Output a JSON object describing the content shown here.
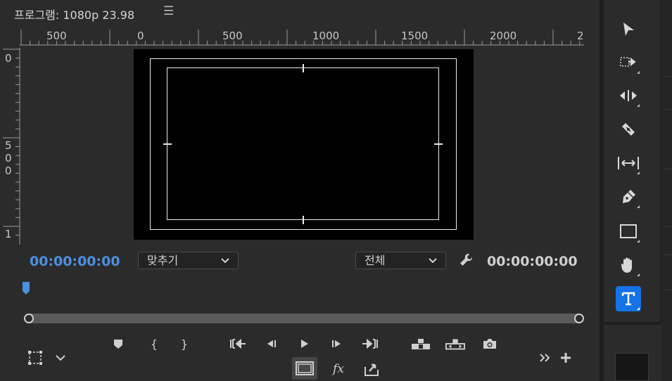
{
  "monitor": {
    "title": "프로그램: 1080p 23.98",
    "menu_icon": "hamburger-menu-icon",
    "ruler_h": {
      "labels": [
        "500",
        "0",
        "500",
        "1000",
        "1500",
        "2000",
        "2"
      ]
    },
    "ruler_v": {
      "labels": [
        "0",
        "5",
        "0",
        "0",
        "1"
      ]
    },
    "timecode_current": "00:00:00:00",
    "timecode_duration": "00:00:00:00",
    "zoom": {
      "value": "맞추기"
    },
    "resolution": {
      "value": "전체"
    }
  },
  "colors": {
    "panel_bg": "#2b2b2b",
    "accent_blue": "#4a90e2",
    "selected_tool": "#1473e6"
  },
  "transport": [
    {
      "name": "add-marker-button",
      "icon": "marker-icon"
    },
    {
      "name": "mark-in-button",
      "icon": "mark-in-icon",
      "glyph": "{"
    },
    {
      "name": "mark-out-button",
      "icon": "mark-out-icon",
      "glyph": "}"
    },
    {
      "name": "go-to-in-button",
      "icon": "go-to-in-icon"
    },
    {
      "name": "step-back-button",
      "icon": "step-back-icon"
    },
    {
      "name": "play-button",
      "icon": "play-icon"
    },
    {
      "name": "step-forward-button",
      "icon": "step-forward-icon"
    },
    {
      "name": "go-to-out-button",
      "icon": "go-to-out-icon"
    },
    {
      "name": "lift-button",
      "icon": "lift-icon"
    },
    {
      "name": "extract-button",
      "icon": "extract-icon"
    },
    {
      "name": "export-frame-button",
      "icon": "camera-icon"
    }
  ],
  "bottom_row": {
    "fx_label": "fx"
  },
  "tools": [
    {
      "name": "selection-tool",
      "icon": "arrow-pointer-icon"
    },
    {
      "name": "track-select-tool",
      "icon": "track-select-icon"
    },
    {
      "name": "ripple-edit-tool",
      "icon": "ripple-edit-icon"
    },
    {
      "name": "razor-tool",
      "icon": "razor-icon"
    },
    {
      "name": "slip-tool",
      "icon": "slip-icon"
    },
    {
      "name": "pen-tool",
      "icon": "pen-icon"
    },
    {
      "name": "rectangle-tool",
      "icon": "rectangle-icon"
    },
    {
      "name": "hand-tool",
      "icon": "hand-icon"
    },
    {
      "name": "type-tool",
      "icon": "type-icon",
      "selected": true
    }
  ]
}
